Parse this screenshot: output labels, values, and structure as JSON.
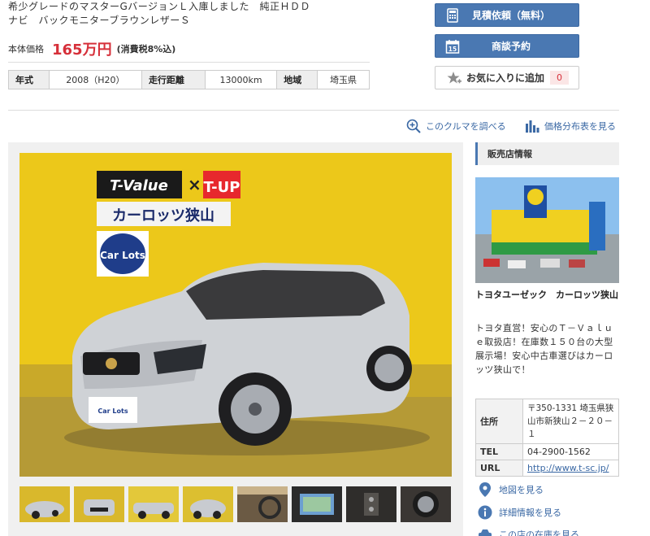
{
  "listing": {
    "description_line1": "希少グレードのマスターGバージョンＬ入庫しました　純正ＨＤＤ",
    "description_line2": "ナビ　バックモニターブラウンレザーＳ",
    "price_label": "本体価格",
    "price_value": "165万円",
    "price_tax": "(消費税8%込)",
    "specs": [
      {
        "label": "年式",
        "value": "2008（H20）"
      },
      {
        "label": "走行距離",
        "value": "13000km"
      },
      {
        "label": "地域",
        "value": "埼玉県"
      }
    ]
  },
  "actions": {
    "estimate_label": "見積依頼（無料）",
    "meeting_label": "商談予約",
    "favorite_label": "お気に入りに追加",
    "favorite_count": "0"
  },
  "tools": {
    "research_label": "このクルマを調べる",
    "price_dist_label": "価格分布表を見る"
  },
  "photo": {
    "sign_tvalue": "T-Value",
    "sign_tup": "T-UP",
    "sign_shop": "カーロッツ狭山",
    "sign_carlots": "Car Lots",
    "plate_text": "Car Lots"
  },
  "thumbnails": [
    "front-left",
    "front",
    "side",
    "rear",
    "interior-dash",
    "navigation",
    "interior-console",
    "wheel"
  ],
  "dealer": {
    "section_title": "販売店情報",
    "name": "トヨタユーゼック　カーロッツ狭山",
    "description": "トヨタ直営！安心のＴ－Ｖａｌｕｅ取扱店！在庫数１５０台の大型展示場！安心中古車選びはカーロッツ狭山で！",
    "address_label": "住所",
    "address": "〒350-1331 埼玉県狭山市新狭山２－２０－１",
    "tel_label": "TEL",
    "tel": "04-2900-1562",
    "url_label": "URL",
    "url": "http://www.t-sc.jp/",
    "map_link": "地図を見る",
    "detail_link": "詳細情報を見る",
    "stock_link": "この店の在庫を見る"
  },
  "colors": {
    "accent_blue": "#4a78b2",
    "price_red": "#d6303a",
    "link_blue": "#3a68a4",
    "wall_yellow": "#e9c81c"
  }
}
